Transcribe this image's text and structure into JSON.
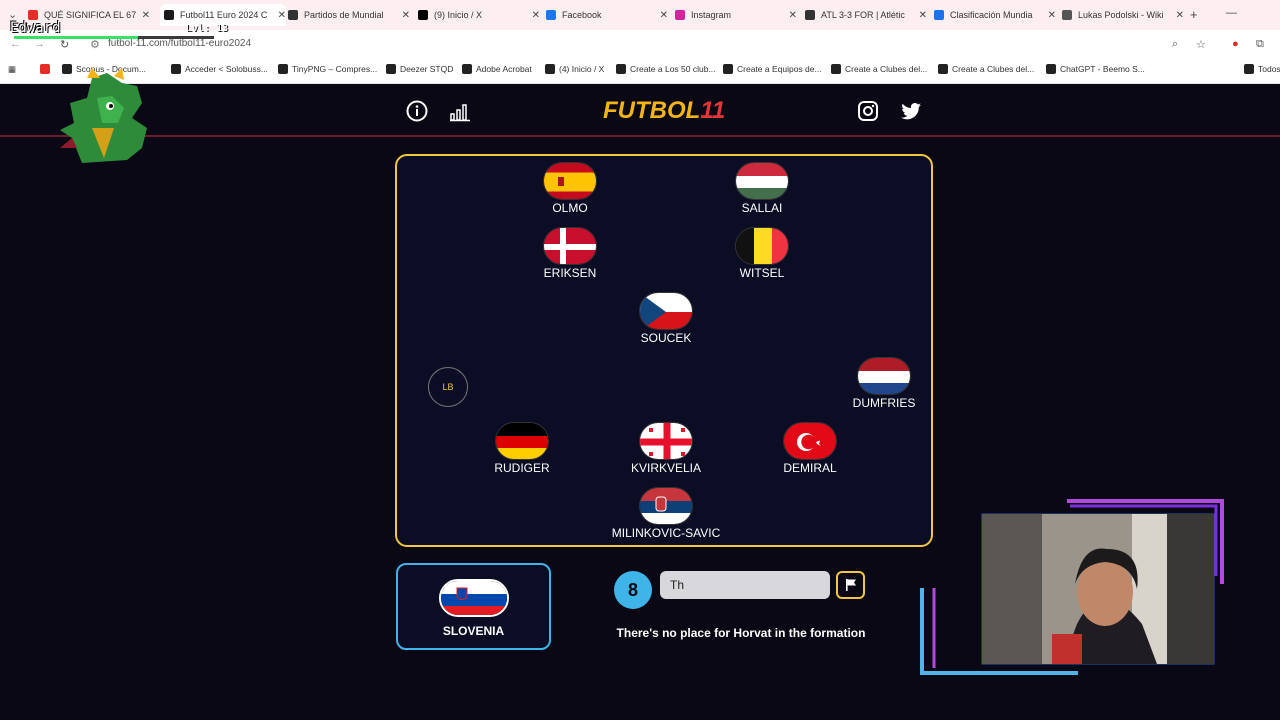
{
  "browser": {
    "tabs": [
      {
        "label": "QUÉ SIGNIFICA EL 67",
        "color": "#e52d27"
      },
      {
        "label": "Futbol11 Euro 2024 C",
        "color": "#1a1a1a",
        "active": true
      },
      {
        "label": "Partidos de Mundial",
        "color": "#333333"
      },
      {
        "label": "(9) Inicio / X",
        "color": "#000000"
      },
      {
        "label": "Facebook",
        "color": "#1877f2"
      },
      {
        "label": "Instagram",
        "color": "#d6249f"
      },
      {
        "label": "ATL 3-3 FOR | Atlétic",
        "color": "#333333"
      },
      {
        "label": "Clasificación Mundia",
        "color": "#1a73e8"
      },
      {
        "label": "Lukas Podolski - Wiki",
        "color": "#555555"
      }
    ],
    "url": "futbol-11.com/futbol11-euro2024",
    "bookmarks": [
      "Scopus - Docum...",
      "Acceder < Solobuss...",
      "TinyPNG – Compres...",
      "Deezer STQD",
      "Adobe Acrobat",
      "(4) Inicio / X",
      "Create a Los 50 club...",
      "Create a Equipos de...",
      "Create a Clubes del...",
      "Create a Clubes del...",
      "ChatGPT - Beemo S...",
      "Todos"
    ]
  },
  "overlay": {
    "username": "Edward",
    "level": "Lvl: 13",
    "xp_progress": 0.62
  },
  "header": {
    "logo_text": "FUTBOL",
    "logo_number": "11",
    "icons": [
      "info-icon",
      "stats-icon",
      "instagram-icon",
      "twitter-icon"
    ]
  },
  "pitch": {
    "players": [
      {
        "name": "OLMO",
        "flag": "spain"
      },
      {
        "name": "SALLAI",
        "flag": "hungary"
      },
      {
        "name": "ERIKSEN",
        "flag": "denmark"
      },
      {
        "name": "WITSEL",
        "flag": "belgium"
      },
      {
        "name": "SOUCEK",
        "flag": "czech"
      },
      {
        "name": "DUMFRIES",
        "flag": "netherlands"
      },
      {
        "name": "RUDIGER",
        "flag": "germany"
      },
      {
        "name": "KVIRKVELIA",
        "flag": "georgia"
      },
      {
        "name": "DEMIRAL",
        "flag": "turkey"
      },
      {
        "name": "MILINKOVIC-SAVIC",
        "flag": "serbia"
      }
    ],
    "empty_slot_label": "LB"
  },
  "current": {
    "country": "SLOVENIA",
    "guesses_left": "8",
    "input_value": "Th",
    "message": "There's no place for Horvat in the formation"
  }
}
